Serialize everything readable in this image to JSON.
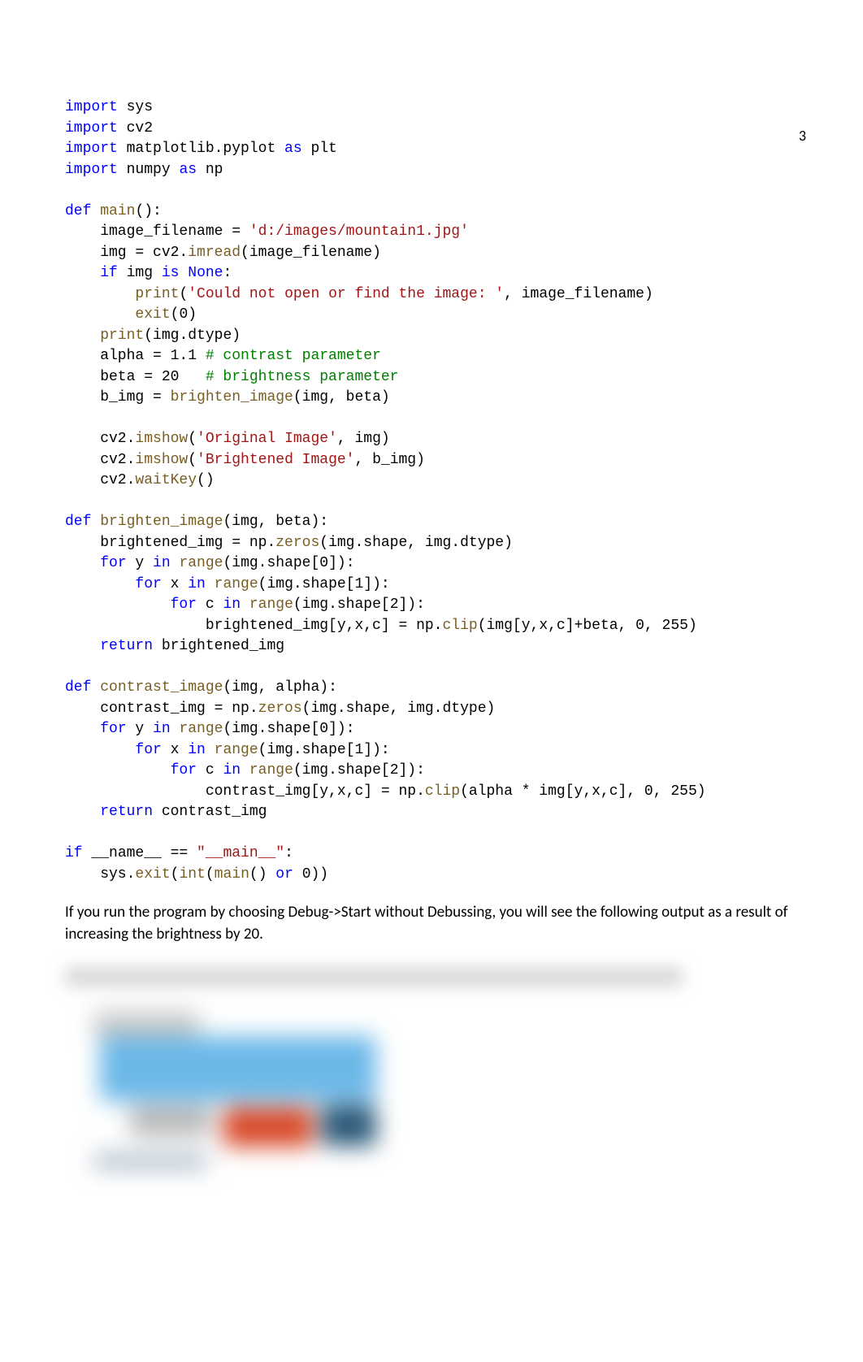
{
  "page_number": "3",
  "code": {
    "l1a": "import",
    "l1b": " sys",
    "l2a": "import",
    "l2b": " cv2",
    "l3a": "import",
    "l3b": " matplotlib.pyplot ",
    "l3c": "as",
    "l3d": " plt",
    "l4a": "import",
    "l4b": " numpy ",
    "l4c": "as",
    "l4d": " np",
    "blank1": "",
    "l5a": "def",
    "l5b": " ",
    "l5c": "main",
    "l5d": "():",
    "l6a": "    image_filename = ",
    "l6b": "'d:/images/mountain1.jpg'",
    "l7a": "    img = cv2.",
    "l7b": "imread",
    "l7c": "(image_filename)",
    "l8a": "    ",
    "l8b": "if",
    "l8c": " img ",
    "l8d": "is",
    "l8e": " ",
    "l8f": "None",
    "l8g": ":",
    "l9a": "        ",
    "l9b": "print",
    "l9c": "(",
    "l9d": "'Could not open or find the image: '",
    "l9e": ", image_filename)",
    "l10a": "        ",
    "l10b": "exit",
    "l10c": "(0)",
    "l11a": "    ",
    "l11b": "print",
    "l11c": "(img.dtype)",
    "l12a": "    alpha = 1.1 ",
    "l12b": "# contrast parameter",
    "l13a": "    beta = 20   ",
    "l13b": "# brightness parameter",
    "l14a": "    b_img = ",
    "l14b": "brighten_image",
    "l14c": "(img, beta)",
    "blank2": "",
    "l15a": "    cv2.",
    "l15b": "imshow",
    "l15c": "(",
    "l15d": "'Original Image'",
    "l15e": ", img)",
    "l16a": "    cv2.",
    "l16b": "imshow",
    "l16c": "(",
    "l16d": "'Brightened Image'",
    "l16e": ", b_img)",
    "l17a": "    cv2.",
    "l17b": "waitKey",
    "l17c": "()",
    "blank3": "",
    "l18a": "def",
    "l18b": " ",
    "l18c": "brighten_image",
    "l18d": "(img, beta):",
    "l19a": "    brightened_img = np.",
    "l19b": "zeros",
    "l19c": "(img.shape, img.dtype)",
    "l20a": "    ",
    "l20b": "for",
    "l20c": " y ",
    "l20d": "in",
    "l20e": " ",
    "l20f": "range",
    "l20g": "(img.shape[0]):",
    "l21a": "        ",
    "l21b": "for",
    "l21c": " x ",
    "l21d": "in",
    "l21e": " ",
    "l21f": "range",
    "l21g": "(img.shape[1]):",
    "l22a": "            ",
    "l22b": "for",
    "l22c": " c ",
    "l22d": "in",
    "l22e": " ",
    "l22f": "range",
    "l22g": "(img.shape[2]):",
    "l23a": "                brightened_img[y,x,c] = np.",
    "l23b": "clip",
    "l23c": "(img[y,x,c]+beta, 0, 255)",
    "l24a": "    ",
    "l24b": "return",
    "l24c": " brightened_img",
    "blank4": "",
    "l25a": "def",
    "l25b": " ",
    "l25c": "contrast_image",
    "l25d": "(img, alpha):",
    "l26a": "    contrast_img = np.",
    "l26b": "zeros",
    "l26c": "(img.shape, img.dtype)",
    "l27a": "    ",
    "l27b": "for",
    "l27c": " y ",
    "l27d": "in",
    "l27e": " ",
    "l27f": "range",
    "l27g": "(img.shape[0]):",
    "l28a": "        ",
    "l28b": "for",
    "l28c": " x ",
    "l28d": "in",
    "l28e": " ",
    "l28f": "range",
    "l28g": "(img.shape[1]):",
    "l29a": "            ",
    "l29b": "for",
    "l29c": " c ",
    "l29d": "in",
    "l29e": " ",
    "l29f": "range",
    "l29g": "(img.shape[2]):",
    "l30a": "                contrast_img[y,x,c] = np.",
    "l30b": "clip",
    "l30c": "(alpha * img[y,x,c], 0, 255)",
    "l31a": "    ",
    "l31b": "return",
    "l31c": " contrast_img",
    "blank5": "",
    "l32a": "if",
    "l32b": " __name__ == ",
    "l32c": "\"__main__\"",
    "l32d": ":",
    "l33a": "    sys.",
    "l33b": "exit",
    "l33c": "(",
    "l33d": "int",
    "l33e": "(",
    "l33f": "main",
    "l33g": "() ",
    "l33h": "or",
    "l33i": " 0))"
  },
  "paragraph": "If you run the program by choosing Debug->Start without Debussing, you will see the following output as a result of increasing the brightness by 20."
}
